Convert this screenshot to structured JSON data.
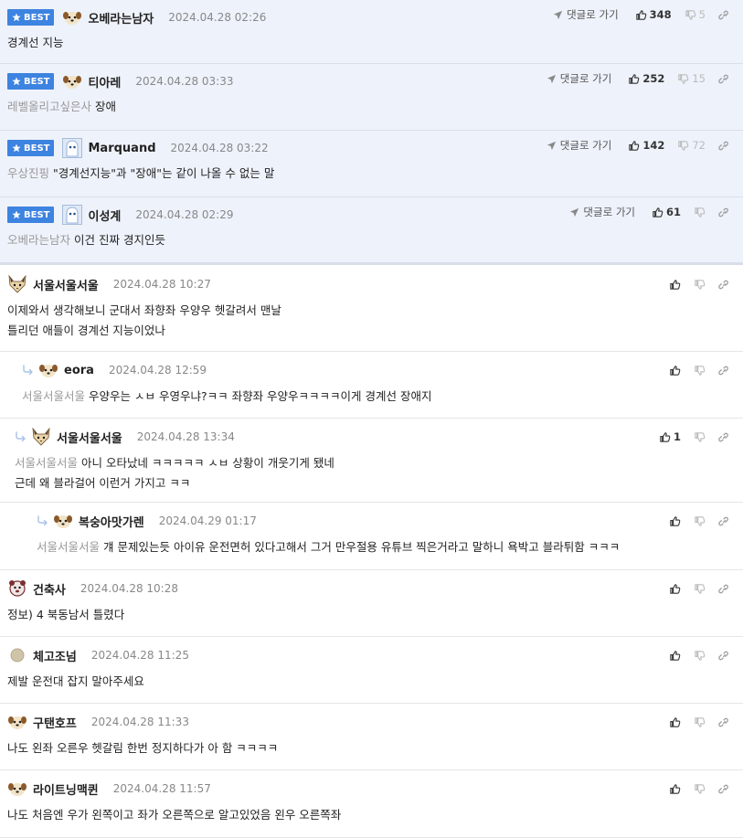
{
  "best_label": "BEST",
  "goto_label": "댓글로 가기",
  "best_comments": [
    {
      "nick": "오베라는남자",
      "date": "2024.04.28 02:26",
      "mention": "",
      "text": "경계선 지능",
      "up": "348",
      "down": "5",
      "avatar": "dog"
    },
    {
      "nick": "티아레",
      "date": "2024.04.28 03:33",
      "mention": "레벨올리고싶은사",
      "text": "장애",
      "up": "252",
      "down": "15",
      "avatar": "dog"
    },
    {
      "nick": "Marquand",
      "date": "2024.04.28 03:22",
      "mention": "우상진핑",
      "text": "\"경계선지능\"과 \"장애\"는 같이 나올 수 없는 말",
      "up": "142",
      "down": "72",
      "avatar": "ghost"
    },
    {
      "nick": "이성계",
      "date": "2024.04.28 02:29",
      "mention": "오베라는남자",
      "text": "이건 진짜 경지인듯",
      "up": "61",
      "down": "",
      "avatar": "ghost"
    }
  ],
  "comments": [
    {
      "nick": "서울서울서울",
      "date": "2024.04.28 10:27",
      "mention": "",
      "lines": [
        "이제와서 생각해보니 군대서 좌향좌 우양우 헷갈려서 맨날",
        "틀리던 애들이 경계선 지능이었나"
      ],
      "up": "",
      "avatar": "fox",
      "depth": 0
    },
    {
      "nick": "eora",
      "date": "2024.04.28 12:59",
      "mention": "서울서울서울",
      "lines": [
        "우양우는 ㅅㅂ 우영우냐?ㅋㅋ 좌향좌 우양우ㅋㅋㅋㅋ이게 경계선 장애지"
      ],
      "up": "",
      "avatar": "dog",
      "depth": 1
    },
    {
      "nick": "서울서울서울",
      "date": "2024.04.28 13:34",
      "mention": "서울서울서울",
      "lines": [
        "아니 오타났네 ㅋㅋㅋㅋㅋ ㅅㅂ 상황이 개웃기게 됐네",
        "근데 왜 블라걸어 이런거 가지고 ㅋㅋ"
      ],
      "up": "1",
      "avatar": "fox",
      "depth": 1
    },
    {
      "nick": "복숭아맛가렌",
      "date": "2024.04.29 01:17",
      "mention": "서울서울서울",
      "lines": [
        "걔 문제있는듯 아이유 운전면허 있다고해서 그거 만우절용 유튜브 찍은거라고 말하니 욕박고 블라튀함 ㅋㅋㅋ"
      ],
      "up": "",
      "avatar": "dog",
      "depth": 2
    },
    {
      "nick": "건축사",
      "date": "2024.04.28 10:28",
      "mention": "",
      "lines": [
        "정보) 4 북동남서 틀렸다"
      ],
      "up": "",
      "avatar": "bear",
      "depth": 0
    },
    {
      "nick": "체고조넘",
      "date": "2024.04.28 11:25",
      "mention": "",
      "lines": [
        "제발 운전대 잡지 말아주세요"
      ],
      "up": "",
      "avatar": "dot",
      "depth": 0
    },
    {
      "nick": "구탠호프",
      "date": "2024.04.28 11:33",
      "mention": "",
      "lines": [
        "나도 왼좌 오른우 헷갈림 한번 정지하다가 아 함 ㅋㅋㅋㅋ"
      ],
      "up": "",
      "avatar": "dog",
      "depth": 0
    },
    {
      "nick": "라이트닝맥퀸",
      "date": "2024.04.28 11:57",
      "mention": "",
      "lines": [
        "나도 처음엔 우가 왼쪽이고 좌가 오른쪽으로 알고있었음 왼우 오른쪽좌"
      ],
      "up": "",
      "avatar": "dog",
      "depth": 0
    }
  ]
}
